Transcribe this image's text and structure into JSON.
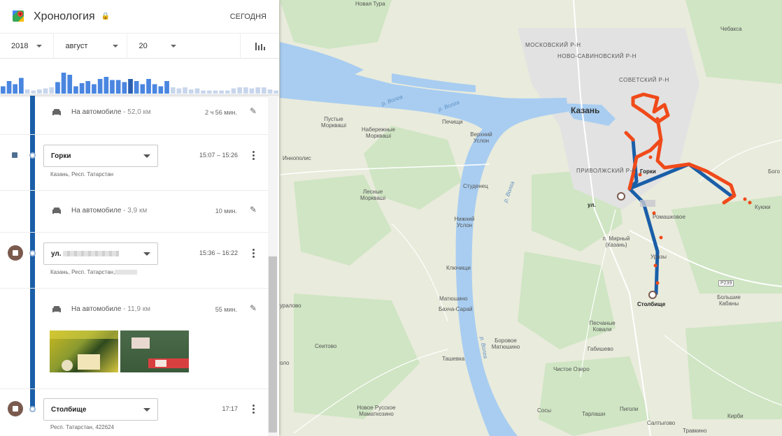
{
  "header": {
    "title": "Хронология",
    "today_label": "СЕГОДНЯ"
  },
  "date_picker": {
    "year": "2018",
    "month": "август",
    "day": "20"
  },
  "histogram": {
    "values": [
      0.35,
      0.6,
      0.45,
      0.75,
      0.2,
      0.15,
      0.2,
      0.25,
      0.3,
      0.55,
      1.0,
      0.9,
      0.35,
      0.5,
      0.6,
      0.45,
      0.7,
      0.8,
      0.65,
      0.65,
      0.55,
      0.7,
      0.6,
      0.45,
      0.7,
      0.45,
      0.35,
      0.6,
      0.3,
      0.25,
      0.3,
      0.2,
      0.25,
      0.15,
      0.15,
      0.15,
      0.15,
      0.15,
      0.25,
      0.3,
      0.3,
      0.25,
      0.3,
      0.3,
      0.2,
      0.15
    ],
    "highlight_index": 21
  },
  "timeline": {
    "move1": {
      "label": "На автомобиле",
      "distance": " - 52,0 км",
      "duration": "2 ч 56 мин."
    },
    "place1": {
      "name": "Горки",
      "address": "Казань, Респ. Татарстан",
      "time": "15:07 – 15:26"
    },
    "move2": {
      "label": "На автомобиле",
      "distance": " - 3,9 км",
      "duration": "10 мин."
    },
    "place2": {
      "name": "ул.",
      "address": "Казань, Респ. Татарстан,",
      "time": "15:36 – 16:22"
    },
    "move3": {
      "label": "На автомобиле",
      "distance": " - 11,9 км",
      "duration": "55 мин."
    },
    "place3": {
      "name": "Столбище",
      "address": "Респ. Татарстан, 422624",
      "time": "17:17"
    }
  },
  "map": {
    "labels": {
      "novaya_tura": "Новая Тура",
      "moskovsky": "МОСКОВСКИЙ Р-Н",
      "novo_savinovsky": "НОВО-САВИНОВСКИЙ Р-Н",
      "sovetsky": "СОВЕТСКИЙ Р-Н",
      "chebaksa": "Чебакса",
      "kazan": "Казань",
      "pustye_morkvashi": "Пустые Морквашi",
      "naberezhnye_morkvashi": "Набережные Морквашi",
      "pechishchi": "Печищи",
      "verkhniy_uslon": "Верхний Услон",
      "innopolis": "Иннополис",
      "privolzhsky": "ПРИВОЛЖСКИЙ Р-Н",
      "gorki_map": "Горки",
      "bogo": "Бого",
      "studenets": "Студенец",
      "lesnye_morkvashi": "Лесные Морквашi",
      "ul_map": "ул.",
      "romashkovoe": "Ромашковое",
      "kuyuki": "Куюки",
      "nizhniy_uslon": "Нижний Услон",
      "p_mirnyy": "п. Мирный (Казань)",
      "klyuchishchi": "Ключищи",
      "uzdy": "Уразы",
      "r239": "Р239",
      "matyushino": "Матюшино",
      "bakhcha_saray": "Бахча-Сарай",
      "stolbishche_map": "Столбище",
      "bolshie_kabany": "Большие Кабаны",
      "uralovo": "уралово",
      "pesch_kovali": "Песчаные Ковали",
      "borovoe_matyushino": "Боровое Матюшино",
      "seitovo": "Сеитово",
      "gabishevo": "Габишево",
      "dolo": "оло",
      "tashevka": "Ташевка",
      "chistoe_ozero": "Чистое Озеро",
      "novoe_russkoe": "Новое Русское Маматкозино",
      "sosy": "Сосы",
      "pigoli": "Пиголи",
      "tarlashi": "Тарлаши",
      "kirbi": "Кирби",
      "saltygovo": "Салтыгово",
      "travkino": "Травкино",
      "volga1": "р. Волга",
      "volga2": "р. Волга",
      "volga3": "р. Волга",
      "volga4": "р. Волга"
    },
    "colors": {
      "route_blue": "#1a5ea8",
      "route_orange": "#f04a1a",
      "water": "#a7cdf0",
      "land": "#e8ead9",
      "green": "#cde6c2"
    }
  }
}
